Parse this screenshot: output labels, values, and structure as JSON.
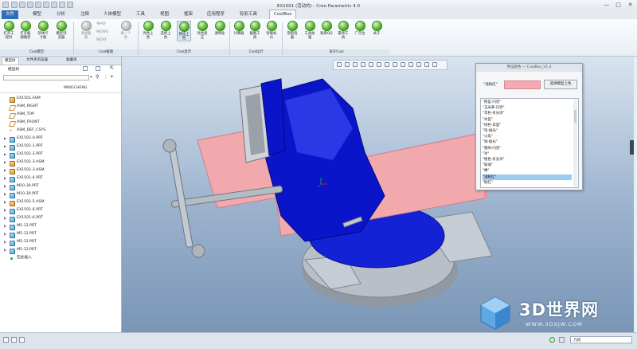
{
  "window": {
    "title": "EX1501 (活动的) - Creo Parametric 4.0",
    "controls": [
      "—",
      "□",
      "✕"
    ]
  },
  "menu": {
    "tabs": [
      "文件",
      "模型",
      "分析",
      "注释",
      "人体模型",
      "工具",
      "视图",
      "框架",
      "应用程序",
      "轮彩工具",
      "CoolBox"
    ]
  },
  "ribbon": {
    "buttons": [
      {
        "label": "打开工程目"
      },
      {
        "label": "打开截图路径"
      },
      {
        "label": "装体尺寸报"
      },
      {
        "label": "模型浏览器"
      },
      {
        "label": "添加截图"
      },
      {
        "label": "导PDF"
      },
      {
        "label": "导DWG"
      },
      {
        "label": "导DXF"
      },
      {
        "label": "换一个色"
      },
      {
        "label": "亮色上色"
      },
      {
        "label": "选择上色"
      },
      {
        "label": "预设上色"
      },
      {
        "label": "亮色遮正"
      },
      {
        "label": "透明化"
      },
      {
        "label": "计算器"
      },
      {
        "label": "截图工具"
      },
      {
        "label": "智能标价"
      },
      {
        "label": "塑胶电器"
      },
      {
        "label": "工具加强"
      },
      {
        "label": "联系QQ"
      },
      {
        "label": "豪师工具"
      },
      {
        "label": "广告位"
      },
      {
        "label": "关于"
      }
    ],
    "groups": [
      "Cool模型",
      "Cool截图",
      "Cool显示",
      "Cool设计",
      "关于Cool"
    ]
  },
  "left_panel": {
    "tabs": [
      "模型树",
      "文件夹浏览器",
      "收藏夹"
    ],
    "tree_label": "模型树",
    "column_header": "MINGCHENG",
    "items": [
      {
        "label": "EX1501.ASM",
        "icon": "asm",
        "expander": ""
      },
      {
        "label": "ASM_RIGHT",
        "icon": "plane",
        "expander": ""
      },
      {
        "label": "ASM_TOP",
        "icon": "plane",
        "expander": ""
      },
      {
        "label": "ASM_FRONT",
        "icon": "plane",
        "expander": ""
      },
      {
        "label": "ASM_DEF_CSYS",
        "icon": "csys",
        "expander": ""
      },
      {
        "label": "EX1501-0.PRT",
        "icon": "part",
        "expander": "▶"
      },
      {
        "label": "EX1501-1.PRT",
        "icon": "part",
        "expander": "▶"
      },
      {
        "label": "EX1501-2.PRT",
        "icon": "part",
        "expander": "▶"
      },
      {
        "label": "EX1501-3.ASM",
        "icon": "asm",
        "expander": "▶"
      },
      {
        "label": "EX1501-3.ASM",
        "icon": "asm",
        "expander": "▶"
      },
      {
        "label": "EX1501-4.PRT",
        "icon": "part",
        "expander": "▶"
      },
      {
        "label": "M10-30.PRT",
        "icon": "part",
        "expander": "▶"
      },
      {
        "label": "M10-30.PRT",
        "icon": "part",
        "expander": "▶"
      },
      {
        "label": "EX1501-5.ASM",
        "icon": "asm",
        "expander": "▶"
      },
      {
        "label": "EX1501-6.PRT",
        "icon": "part",
        "expander": "▶"
      },
      {
        "label": "EX1501-6.PRT",
        "icon": "part",
        "expander": "▶"
      },
      {
        "label": "M5-12.PRT",
        "icon": "part",
        "expander": "▶"
      },
      {
        "label": "M5-12.PRT",
        "icon": "part",
        "expander": "▶"
      },
      {
        "label": "M5-12.PRT",
        "icon": "part",
        "expander": "▶"
      },
      {
        "label": "M5-12.PRT",
        "icon": "part",
        "expander": "▶"
      },
      {
        "label": "在此插入",
        "icon": "ins",
        "expander": ""
      }
    ]
  },
  "dialog": {
    "title": "预设颜色 — CoolBox_V1.4",
    "color_label": "\"浅粉红\"",
    "button_label": "选择模型上色",
    "swatch_color": "#f4aab0",
    "options": [
      "\"粉蓝-闪亮\"",
      "\"玉米黄-闪亮\"",
      "\"苹色-有光泽\"",
      "\"冰蓝\"",
      "\"绿色-白蛋\"",
      "\"铝-抛光\"",
      "\"火焰\"",
      "\"铜-抛光\"",
      "\"墨绿-闪亮\"",
      "\"冰\"",
      "\"橙色-有光泽\"",
      "\"玻璃\"",
      "\"橡\"",
      "\"浅粉红\"",
      "\"粉红\""
    ],
    "selected_index": 13
  },
  "status": {
    "filter_value": "几何"
  },
  "watermark": {
    "brand": "3D世界网",
    "url": "WWW.3DSJW.COM"
  },
  "colors": {
    "accent": "#2f6fb5",
    "vise_blue": "#0a14c8",
    "vise_pink": "#f1a9ae",
    "vise_gray": "#b9bfc6"
  }
}
